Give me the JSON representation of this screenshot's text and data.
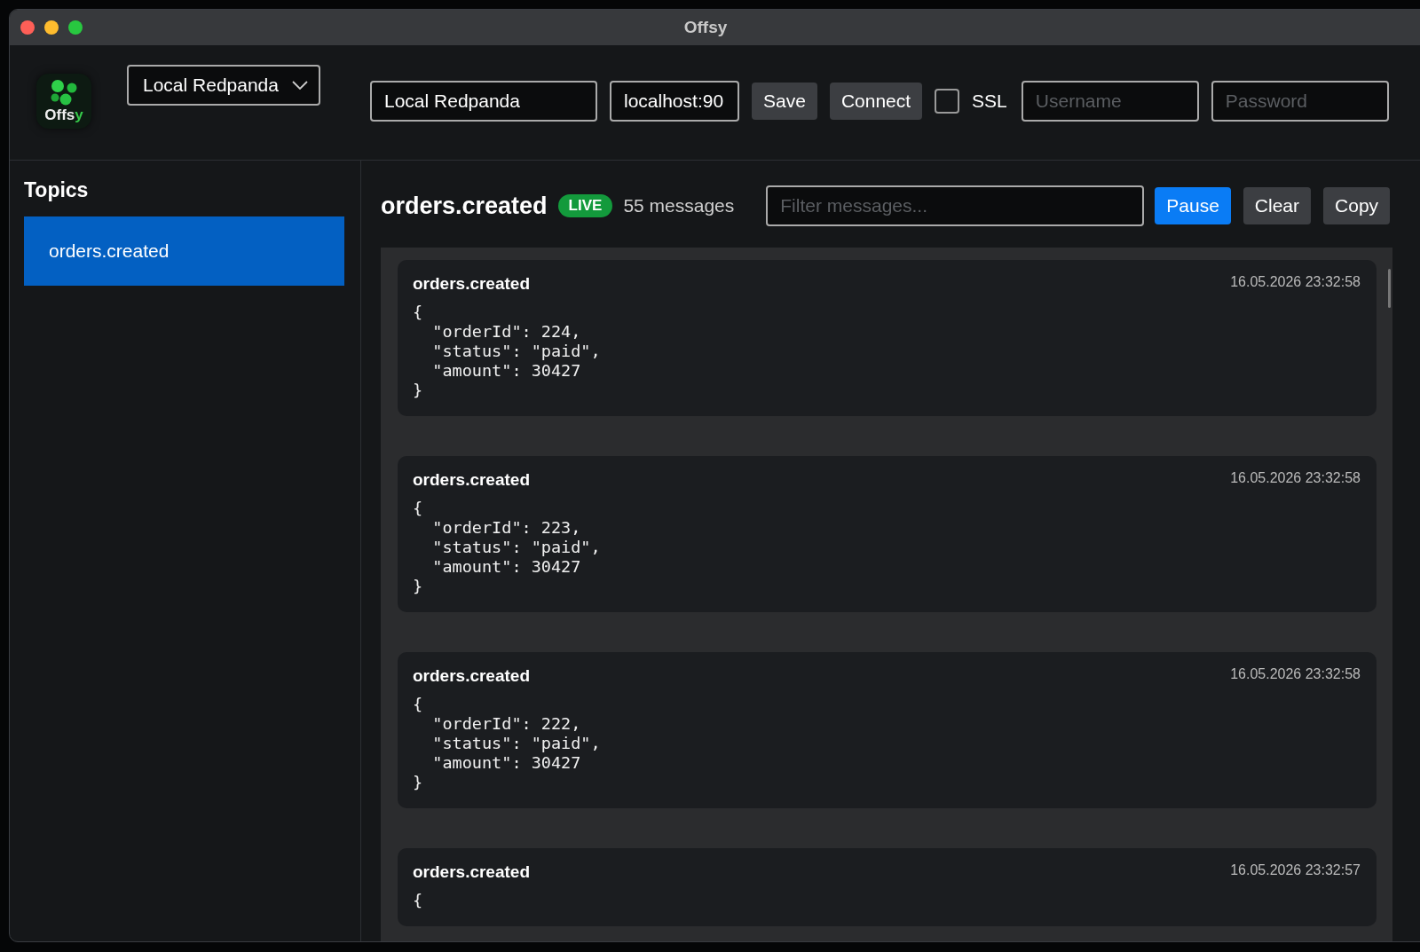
{
  "window": {
    "title": "Offsy"
  },
  "logo": {
    "text": "Offs",
    "accent": "y"
  },
  "connection_select": {
    "value": "Local Redpanda"
  },
  "connection": {
    "name": "Local Redpanda",
    "host": "localhost:90",
    "buttons": [
      {
        "label": "Save",
        "kind": "secondary"
      },
      {
        "label": "Connect",
        "kind": "secondary"
      }
    ],
    "ssl": {
      "label": "SSL",
      "checked": false
    },
    "username": {
      "placeholder": "Username"
    },
    "password": {
      "placeholder": "Password"
    }
  },
  "sidebar": {
    "title": "Topics",
    "items": [
      {
        "label": "orders.created",
        "selected": true
      }
    ]
  },
  "topic": {
    "name": "orders.created",
    "badge": "LIVE",
    "count": "55 messages",
    "filter": {
      "placeholder": "Filter messages..."
    },
    "buttons": [
      {
        "label": "Pause",
        "kind": "primary"
      },
      {
        "label": "Clear",
        "kind": "secondary"
      },
      {
        "label": "Copy",
        "kind": "secondary"
      }
    ]
  },
  "messages": [
    {
      "topic": "orders.created",
      "time": "16.05.2026 23:32:58",
      "body": "{\n  \"orderId\": 224,\n  \"status\": \"paid\",\n  \"amount\": 30427\n}"
    },
    {
      "topic": "orders.created",
      "time": "16.05.2026 23:32:58",
      "body": "{\n  \"orderId\": 223,\n  \"status\": \"paid\",\n  \"amount\": 30427\n}"
    },
    {
      "topic": "orders.created",
      "time": "16.05.2026 23:32:58",
      "body": "{\n  \"orderId\": 222,\n  \"status\": \"paid\",\n  \"amount\": 30427\n}"
    },
    {
      "topic": "orders.created",
      "time": "16.05.2026 23:32:57",
      "body": "{"
    }
  ]
}
